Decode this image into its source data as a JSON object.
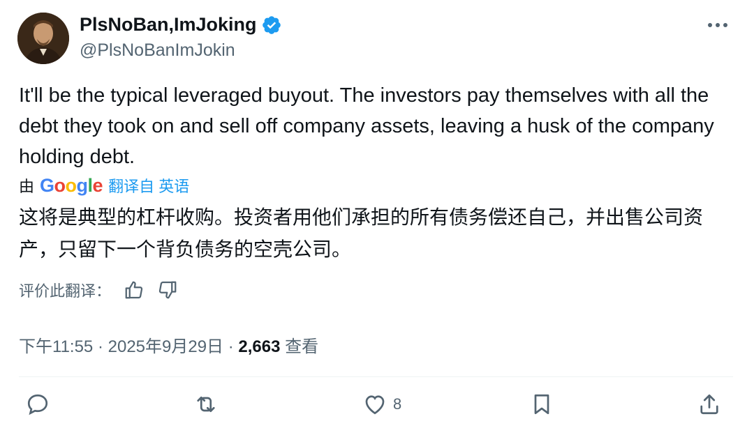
{
  "author": {
    "display_name": "PlsNoBan,ImJoking",
    "handle": "@PlsNoBanImJokin"
  },
  "tweet": {
    "text": "It'll be the typical leveraged buyout. The investors pay themselves with all the debt they took on and sell off company assets, leaving a husk of the company holding debt."
  },
  "translation": {
    "by_label": "由",
    "provider": "Google",
    "link_text": "翻译自 英语",
    "translated_text": "这将是典型的杠杆收购。投资者用他们承担的所有债务偿还自己，并出售公司资产，只留下一个背负债务的空壳公司。",
    "rate_label": "评价此翻译："
  },
  "meta": {
    "time": "下午11:55",
    "date": "2025年9月29日",
    "separator": "·",
    "views_count": "2,663",
    "views_label": "查看"
  },
  "actions": {
    "likes_count": "8"
  },
  "colors": {
    "accent": "#1d9bf0",
    "text": "#0f1419",
    "secondary": "#536471"
  }
}
